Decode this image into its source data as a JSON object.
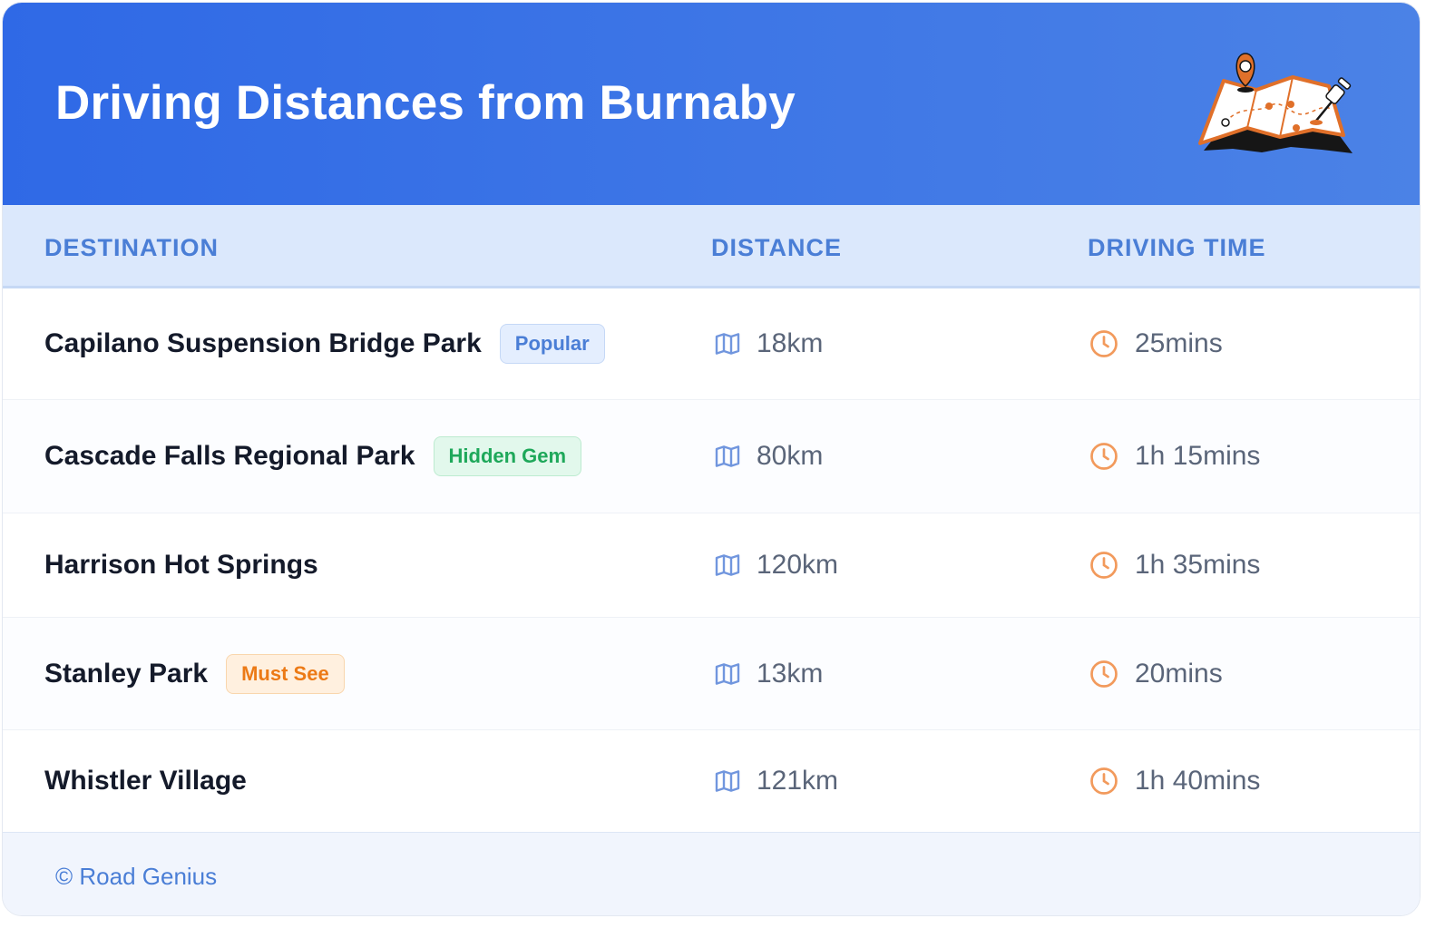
{
  "header": {
    "title": "Driving Distances from Burnaby",
    "illustration": "map-with-location-pin-icon"
  },
  "table": {
    "columns": [
      "DESTINATION",
      "DISTANCE",
      "DRIVING TIME"
    ],
    "rows": [
      {
        "destination": "Capilano Suspension Bridge Park",
        "badge": "Popular",
        "badge_color": "#4a7ed6",
        "distance": "18km",
        "time": "25mins"
      },
      {
        "destination": "Cascade Falls Regional Park",
        "badge": "Hidden Gem",
        "badge_color": "#1ea85a",
        "distance": "80km",
        "time": "1h 15mins"
      },
      {
        "destination": "Harrison Hot Springs",
        "badge": "",
        "distance": "120km",
        "time": "1h 35mins"
      },
      {
        "destination": "Stanley Park",
        "badge": "Must See",
        "badge_color": "#ec7a16",
        "distance": "13km",
        "time": "20mins"
      },
      {
        "destination": "Whistler Village",
        "badge": "",
        "distance": "121km",
        "time": "1h 40mins"
      }
    ],
    "distance_icon": "map-icon",
    "time_icon": "clock-icon"
  },
  "footer": {
    "copyright": "© Road Genius"
  },
  "colors": {
    "header_start": "#2f69e6",
    "header_end": "#4b82e6",
    "accent_blue": "#4a7ed6",
    "accent_orange": "#ec7a16"
  }
}
